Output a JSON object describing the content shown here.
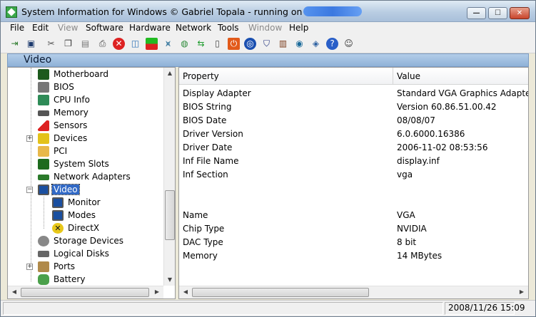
{
  "window": {
    "title": "System Information for Windows  © Gabriel Topala - running on",
    "buttons": {
      "minimize": "—",
      "maximize": "☐",
      "close": "✕"
    }
  },
  "menubar": [
    "File",
    "Edit",
    "View",
    "Software",
    "Hardware",
    "Network",
    "Tools",
    "Window",
    "Help"
  ],
  "section": {
    "title": "Video"
  },
  "tree": {
    "items": [
      {
        "label": "Motherboard",
        "icon": "motherboard-icon"
      },
      {
        "label": "BIOS",
        "icon": "bios-chip-icon"
      },
      {
        "label": "CPU Info",
        "icon": "cpu-icon"
      },
      {
        "label": "Memory",
        "icon": "memory-icon"
      },
      {
        "label": "Sensors",
        "icon": "thermometer-icon"
      },
      {
        "label": "Devices",
        "icon": "devices-icon"
      },
      {
        "label": "PCI",
        "icon": "pci-card-icon"
      },
      {
        "label": "System Slots",
        "icon": "slots-icon"
      },
      {
        "label": "Network Adapters",
        "icon": "network-adapter-icon"
      },
      {
        "label": "Video",
        "icon": "monitor-icon"
      },
      {
        "label": "Monitor",
        "icon": "monitor-icon"
      },
      {
        "label": "Modes",
        "icon": "monitor-icon"
      },
      {
        "label": "DirectX",
        "icon": "directx-icon"
      },
      {
        "label": "Storage Devices",
        "icon": "storage-icon"
      },
      {
        "label": "Logical Disks",
        "icon": "disk-icon"
      },
      {
        "label": "Ports",
        "icon": "ports-icon"
      },
      {
        "label": "Battery",
        "icon": "battery-icon"
      }
    ]
  },
  "details": {
    "headers": {
      "property": "Property",
      "value": "Value"
    },
    "rows": [
      {
        "property": "Display Adapter",
        "value": "Standard VGA Graphics Adapter"
      },
      {
        "property": "BIOS String",
        "value": "Version 60.86.51.00.42"
      },
      {
        "property": "BIOS Date",
        "value": "08/08/07"
      },
      {
        "property": "Driver Version",
        "value": "6.0.6000.16386"
      },
      {
        "property": "Driver Date",
        "value": "2006-11-02 08:53:56"
      },
      {
        "property": "Inf File Name",
        "value": "display.inf"
      },
      {
        "property": "Inf Section",
        "value": "vga"
      },
      {
        "property": "Name",
        "value": "VGA"
      },
      {
        "property": "Chip Type",
        "value": "NVIDIA"
      },
      {
        "property": "DAC Type",
        "value": "8 bit"
      },
      {
        "property": "Memory",
        "value": "14 MBytes"
      }
    ]
  },
  "statusbar": {
    "datetime": "2008/11/26 15:09"
  },
  "colors": {
    "selection": "#3169c6",
    "header_band": "#a9c6e6"
  }
}
